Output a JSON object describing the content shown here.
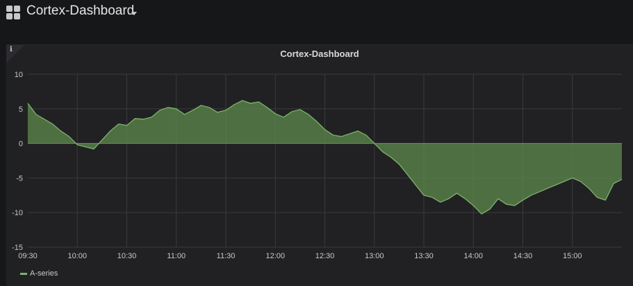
{
  "header": {
    "title": "Cortex-Dashboard",
    "grid_icon": "apps-grid-icon",
    "caret_icon": "caret-down-icon"
  },
  "panel": {
    "title": "Cortex-Dashboard",
    "info_glyph": "i",
    "info_icon": "info-icon"
  },
  "colors": {
    "background": "#161719",
    "panel": "#212124",
    "series_line": "#7eb26d",
    "series_fill": "#5e8a4c",
    "grid": "#3a3a3d"
  },
  "chart_data": {
    "type": "area",
    "x_tick_labels": [
      "09:30",
      "10:00",
      "10:30",
      "11:00",
      "11:30",
      "12:00",
      "12:30",
      "13:00",
      "13:30",
      "14:00",
      "14:30",
      "15:00"
    ],
    "y_tick_labels": [
      "10",
      "5",
      "0",
      "-5",
      "-10",
      "-15"
    ],
    "ylim": [
      -15,
      10
    ],
    "x_unit": "minutes after 09:30",
    "xlim": [
      0,
      360
    ],
    "grid": true,
    "legend_position": "bottom-left",
    "series": [
      {
        "name": "A-series",
        "x": [
          0,
          5,
          10,
          15,
          20,
          25,
          30,
          35,
          40,
          45,
          50,
          55,
          60,
          65,
          70,
          75,
          80,
          85,
          90,
          95,
          100,
          105,
          110,
          115,
          120,
          125,
          130,
          135,
          140,
          145,
          150,
          155,
          160,
          165,
          170,
          175,
          180,
          185,
          190,
          195,
          200,
          205,
          210,
          215,
          220,
          225,
          230,
          235,
          240,
          245,
          250,
          255,
          260,
          265,
          270,
          275,
          280,
          285,
          290,
          295,
          300,
          305,
          310,
          315,
          320,
          325,
          330,
          335,
          340,
          345,
          350,
          355,
          360
        ],
        "y": [
          5.8,
          4.2,
          3.5,
          2.8,
          1.8,
          1.0,
          -0.2,
          -0.5,
          -0.8,
          0.5,
          1.8,
          2.8,
          2.6,
          3.6,
          3.5,
          3.8,
          4.8,
          5.2,
          5.0,
          4.2,
          4.8,
          5.5,
          5.2,
          4.5,
          4.8,
          5.6,
          6.2,
          5.8,
          6.0,
          5.2,
          4.3,
          3.8,
          4.6,
          4.9,
          4.2,
          3.2,
          2.0,
          1.2,
          1.0,
          1.4,
          1.8,
          1.2,
          0.0,
          -1.2,
          -2.0,
          -3.0,
          -4.5,
          -6.0,
          -7.5,
          -7.8,
          -8.5,
          -8.0,
          -7.2,
          -8.0,
          -9.0,
          -10.2,
          -9.5,
          -8.0,
          -8.8,
          -9.0,
          -8.2,
          -7.5,
          -7.0,
          -6.5,
          -6.0,
          -5.5,
          -5.0,
          -5.5,
          -6.5,
          -7.8,
          -8.2,
          -5.8,
          -5.2
        ]
      }
    ]
  }
}
